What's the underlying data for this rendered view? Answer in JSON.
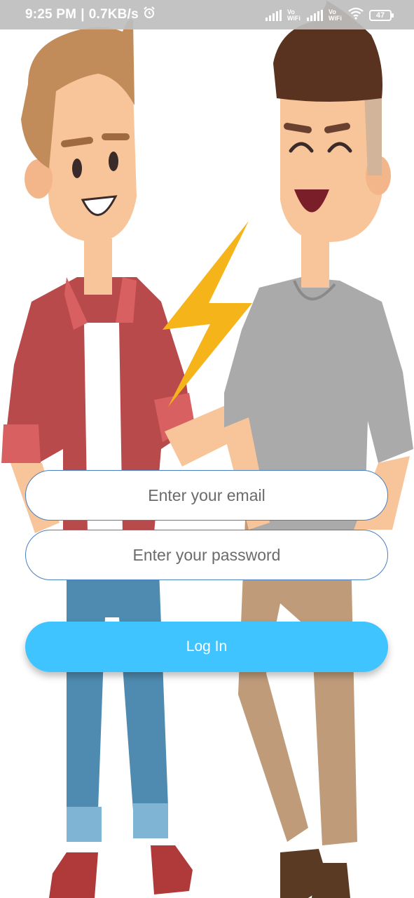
{
  "status_bar": {
    "time": "9:25 PM",
    "speed": "0.7KB/s",
    "alarm_icon": "alarm-clock-icon",
    "signal_icon": "cell-signal-icon",
    "vowifi_1": "Vo WiFi",
    "vowifi_2": "Vo WiFi",
    "wifi_icon": "wifi-icon",
    "battery": "47"
  },
  "illustration": {
    "subject": "two-friends-illustration"
  },
  "form": {
    "email_placeholder": "Enter your email",
    "password_placeholder": "Enter your password",
    "login_label": "Log In"
  },
  "colors": {
    "button": "#40c4ff",
    "field_border": "#4a7fc1"
  }
}
